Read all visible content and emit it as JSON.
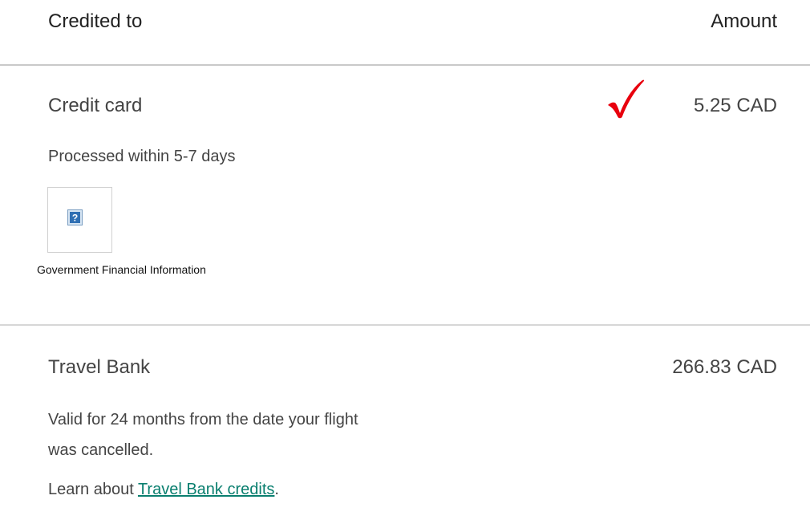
{
  "header": {
    "credited_to": "Credited to",
    "amount": "Amount"
  },
  "credit_card": {
    "title": "Credit card",
    "amount": "5.25 CAD",
    "note": "Processed within 5-7 days",
    "selected": true,
    "check_icon": "check-mark-icon",
    "check_color": "#e8000d",
    "info_image_caption": "Government Financial Information",
    "info_icon": "question-icon"
  },
  "travel_bank": {
    "title": "Travel Bank",
    "amount": "266.83 CAD",
    "description": "Valid for 24 months from the date your flight was cancelled.",
    "learn_prefix": "Learn about ",
    "learn_link": "Travel Bank credits",
    "learn_suffix": ".",
    "link_color": "#0a7f6f"
  }
}
